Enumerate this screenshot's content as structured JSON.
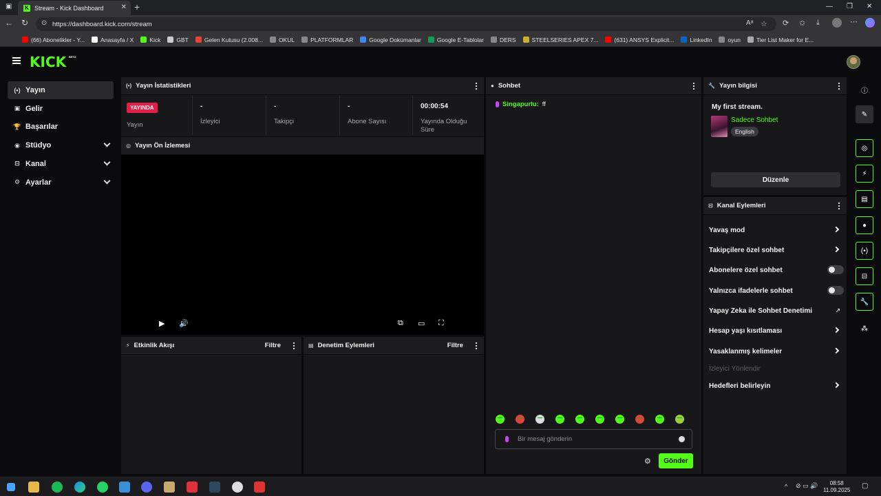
{
  "browser": {
    "tab_title": "Stream - Kick Dashboard",
    "url": "https://dashboard.kick.com/stream",
    "bookmarks": [
      {
        "label": "(66) Abonelikler - Y...",
        "color": "#ff0000"
      },
      {
        "label": "Anasayfa / X",
        "color": "#ffffff"
      },
      {
        "label": "Kick",
        "color": "#53fc18"
      },
      {
        "label": "GBT",
        "color": "#cccccc"
      },
      {
        "label": "Gelen Kutusu (2.008...",
        "color": "#ea4335"
      },
      {
        "label": "OKUL",
        "color": "#888888"
      },
      {
        "label": "PLATFORMLAR",
        "color": "#888888"
      },
      {
        "label": "Google Dokümanlar",
        "color": "#4285f4"
      },
      {
        "label": "Google E-Tablolar",
        "color": "#0f9d58"
      },
      {
        "label": "DERS",
        "color": "#888888"
      },
      {
        "label": "STEELSERIES APEX 7...",
        "color": "#c9b037"
      },
      {
        "label": "(631) ANSYS Explicit...",
        "color": "#ff0000"
      },
      {
        "label": "LinkedIn",
        "color": "#0a66c2"
      },
      {
        "label": "oyun",
        "color": "#888888"
      },
      {
        "label": "Tier List Maker for E...",
        "color": "#aaaaaa"
      }
    ]
  },
  "app": {
    "logo": "KICK",
    "logo_badge": "BETA",
    "accent": "#53fc18"
  },
  "sidebar": {
    "items": [
      {
        "label": "Yayın",
        "icon": "broadcast-icon",
        "glyph": "(•)",
        "active": true
      },
      {
        "label": "Gelir",
        "icon": "revenue-icon",
        "glyph": "▣",
        "active": false
      },
      {
        "label": "Başarılar",
        "icon": "trophy-icon",
        "glyph": "🏆",
        "active": false
      },
      {
        "label": "Stüdyo",
        "icon": "studio-icon",
        "glyph": "◉",
        "active": false,
        "expandable": true
      },
      {
        "label": "Kanal",
        "icon": "channel-icon",
        "glyph": "⊟",
        "active": false,
        "expandable": true
      },
      {
        "label": "Ayarlar",
        "icon": "settings-icon",
        "glyph": "⚙",
        "active": false,
        "expandable": true
      }
    ]
  },
  "stats": {
    "title": "Yayın İstatistikleri",
    "live_badge": "YAYINDA",
    "items": [
      {
        "value": "",
        "label": "Yayın"
      },
      {
        "value": "-",
        "label": "İzleyici"
      },
      {
        "value": "-",
        "label": "Takipçi"
      },
      {
        "value": "-",
        "label": "Abone Sayısı"
      },
      {
        "value": "00:00:54",
        "label": "Yayında Olduğu Süre"
      }
    ]
  },
  "preview": {
    "title": "Yayın Ön İzlemesi"
  },
  "activity": {
    "title": "Etkinlik Akışı",
    "filter": "Filtre"
  },
  "moderation": {
    "title": "Denetim Eylemleri",
    "filter": "Filtre"
  },
  "chat": {
    "title": "Sohbet",
    "messages": [
      {
        "user": "Singapurlu:",
        "text": "ff"
      }
    ],
    "placeholder": "Bir mesaj gönderin",
    "send_label": "Gönder"
  },
  "stream_info": {
    "title": "Yayın bilgisi",
    "stream_title": "My first stream.",
    "category": "Sadece Sohbet",
    "language": "English",
    "edit_label": "Düzenle"
  },
  "channel_actions": {
    "title": "Kanal Eylemleri",
    "items": [
      {
        "label": "Yavaş mod",
        "kind": "arrow"
      },
      {
        "label": "Takipçilere özel sohbet",
        "kind": "arrow"
      },
      {
        "label": "Abonelere özel sohbet",
        "kind": "toggle"
      },
      {
        "label": "Yalnızca ifadelerle sohbet",
        "kind": "toggle"
      },
      {
        "label": "Yapay Zeka ile Sohbet Denetimi",
        "kind": "external"
      },
      {
        "label": "Hesap yaşı kısıtlaması",
        "kind": "arrow"
      },
      {
        "label": "Yasaklanmış kelimeler",
        "kind": "arrow"
      },
      {
        "label": "İzleyici Yönlendir",
        "kind": "disabled"
      },
      {
        "label": "Hedefleri belirleyin",
        "kind": "arrow"
      }
    ]
  },
  "taskbar": {
    "time": "08:58",
    "date": "11.09.2025"
  }
}
